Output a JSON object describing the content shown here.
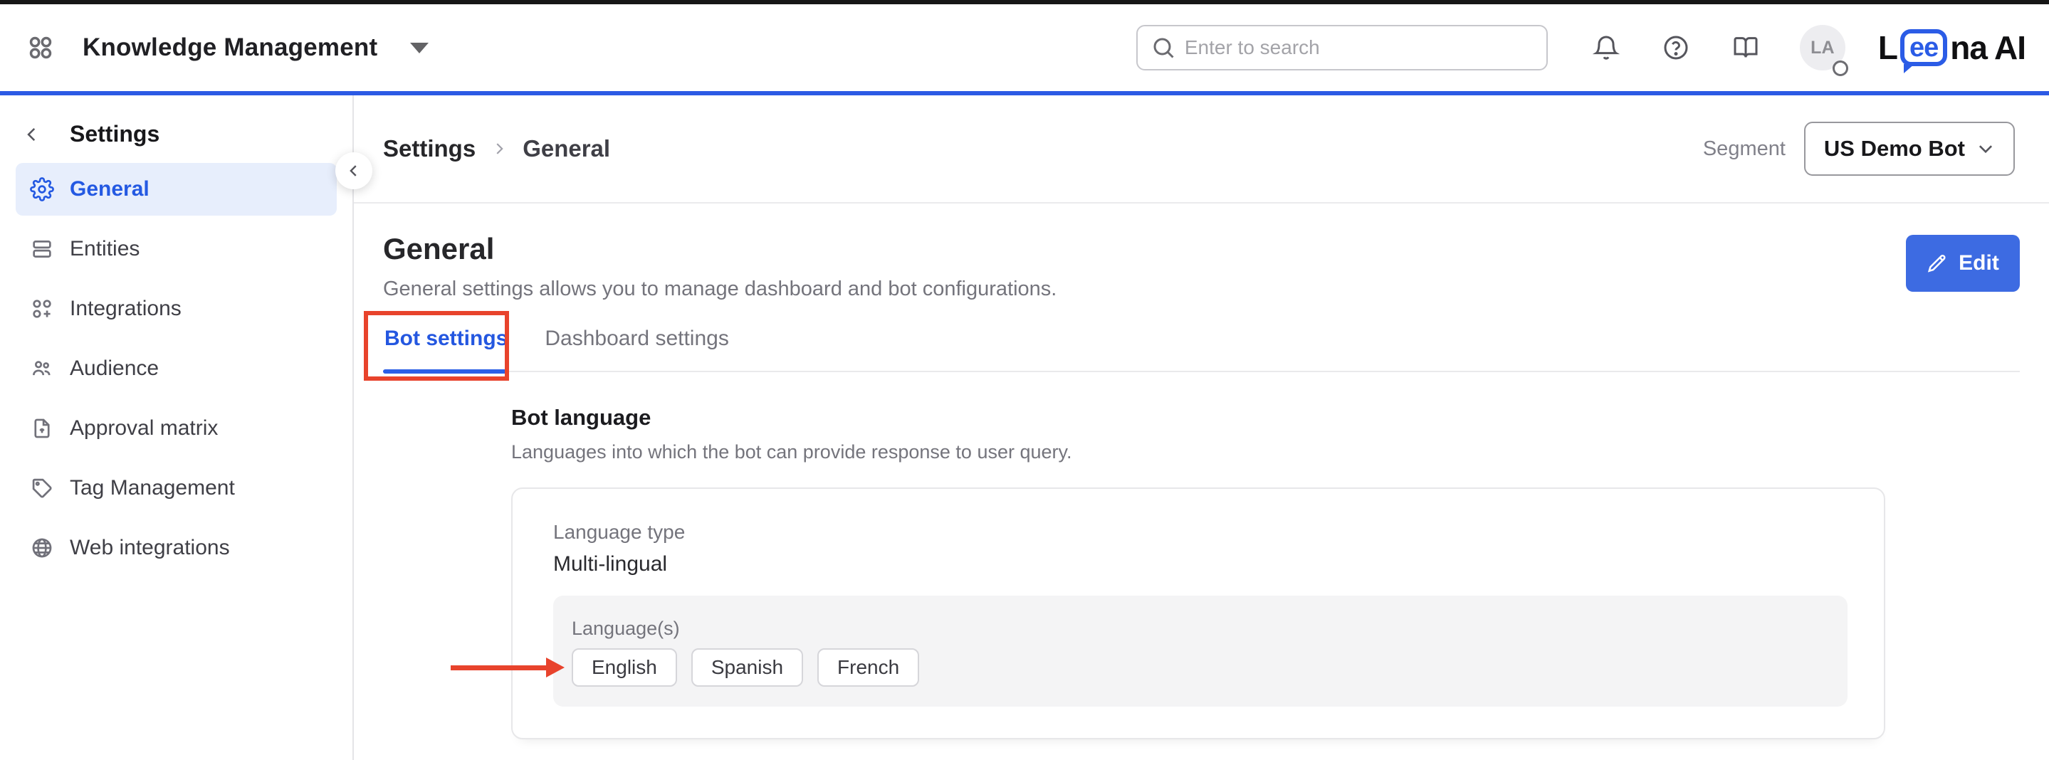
{
  "colors": {
    "accent_blue": "#2457e0",
    "header_line_blue": "#2c5ae4",
    "button_blue": "#3d6be2",
    "annotation_red": "#e8432c",
    "active_item_bg": "#e7eefc",
    "panel_gray": "#f4f4f5"
  },
  "header": {
    "app_title": "Knowledge Management",
    "search_placeholder": "Enter to search",
    "icons": [
      "grid-icon",
      "search-icon",
      "bell-icon",
      "help-icon",
      "book-icon"
    ],
    "avatar_initials": "LA",
    "logo": {
      "prefix": "L",
      "bubble": "ee",
      "suffix": "na AI"
    }
  },
  "sidebar": {
    "title": "Settings",
    "items": [
      {
        "label": "General",
        "icon": "gear",
        "active": true
      },
      {
        "label": "Entities",
        "icon": "rows",
        "active": false
      },
      {
        "label": "Integrations",
        "icon": "apps-plus",
        "active": false
      },
      {
        "label": "Audience",
        "icon": "users",
        "active": false
      },
      {
        "label": "Approval matrix",
        "icon": "file-arrow-up",
        "active": false
      },
      {
        "label": "Tag Management",
        "icon": "tag",
        "active": false
      },
      {
        "label": "Web integrations",
        "icon": "globe",
        "active": false
      }
    ]
  },
  "main": {
    "breadcrumb": {
      "root": "Settings",
      "current": "General"
    },
    "segment_label": "Segment",
    "segment_value": "US Demo Bot",
    "title": "General",
    "description": "General settings allows you to manage dashboard and bot configurations.",
    "edit_label": "Edit",
    "tabs": [
      {
        "label": "Bot settings",
        "active": true
      },
      {
        "label": "Dashboard settings",
        "active": false
      }
    ],
    "bot_language": {
      "title": "Bot language",
      "description": "Languages into which the bot can provide response to user query.",
      "language_type_label": "Language type",
      "language_type_value": "Multi-lingual",
      "languages_label": "Language(s)",
      "languages": [
        "English",
        "Spanish",
        "French"
      ]
    }
  }
}
